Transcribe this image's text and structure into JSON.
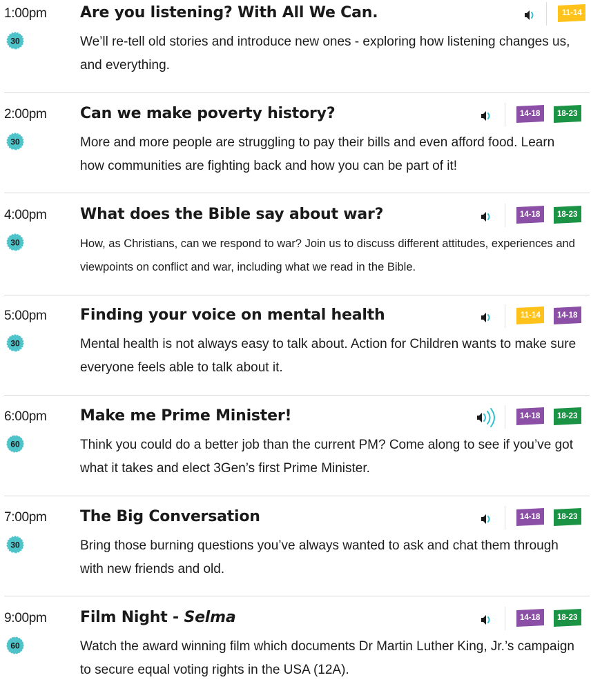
{
  "colors": {
    "badge_11_14": "#ffc21a",
    "badge_14_18": "#8c4fa6",
    "badge_18_23": "#1a9444",
    "duration_teal": "#4ec3c9",
    "audio_active": "#35c0cf",
    "divider": "#d6d6d6"
  },
  "events": [
    {
      "time": "1:00pm",
      "duration": "30",
      "title": "Are you listening? With All We Can.",
      "description": "We’ll re-tell old stories and introduce new ones - exploring how listening changes us, and everything.",
      "audio_icon": "speaker-low-icon",
      "badges": [
        "11-14"
      ]
    },
    {
      "time": "2:00pm",
      "duration": "30",
      "title": "Can we make poverty history?",
      "description": "More and more people are struggling to pay their bills and even afford food. Learn how communities are fighting back and how you can be part of it!",
      "audio_icon": "speaker-low-icon",
      "badges": [
        "14-18",
        "18-23"
      ]
    },
    {
      "time": "4:00pm",
      "duration": "30",
      "title": "What does the Bible say about war?",
      "description": "How, as Christians, can we respond to war? Join us to discuss different attitudes, experiences and viewpoints on conflict and war, including what we read in the Bible.",
      "audio_icon": "speaker-low-icon",
      "badges": [
        "14-18",
        "18-23"
      ]
    },
    {
      "time": "5:00pm",
      "duration": "30",
      "title": "Finding your voice on mental health",
      "description": "Mental health is not always easy to talk about. Action for Children wants to make sure everyone feels able to talk about it.",
      "audio_icon": "speaker-low-icon",
      "badges": [
        "11-14",
        "14-18"
      ]
    },
    {
      "time": "6:00pm",
      "duration": "60",
      "title": "Make me Prime Minister!",
      "description": "Think you could do a better job than the current PM? Come along to see if you’ve got what it takes and elect 3Gen’s first Prime Minister.",
      "audio_icon": "speaker-loud-icon",
      "badges": [
        "14-18",
        "18-23"
      ]
    },
    {
      "time": "7:00pm",
      "duration": "30",
      "title": "The Big Conversation",
      "description": "Bring those burning questions you’ve always wanted to ask and chat them through with new friends and old.",
      "audio_icon": "speaker-low-icon",
      "badges": [
        "14-18",
        "18-23"
      ]
    },
    {
      "time": "9:00pm",
      "duration": "60",
      "title": "Film Night - ",
      "title_emphasis": "Selma",
      "description": "Watch the award winning film which documents Dr Martin Luther King, Jr.’s campaign to secure equal voting rights in the USA (12A).",
      "audio_icon": "speaker-low-icon",
      "badges": [
        "14-18",
        "18-23"
      ]
    }
  ]
}
